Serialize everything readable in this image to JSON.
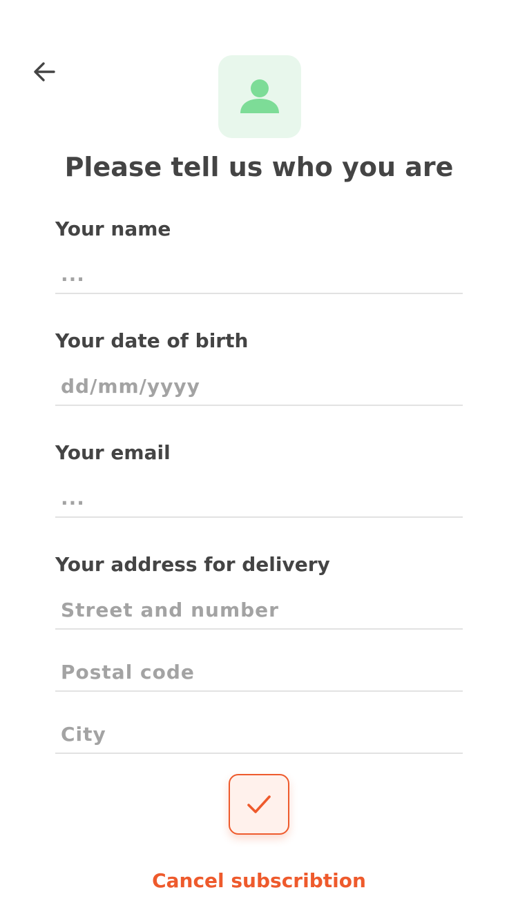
{
  "header": {
    "back_icon": "arrow-left-icon",
    "avatar_icon": "user-icon",
    "title": "Please tell us who you are"
  },
  "form": {
    "name": {
      "label": "Your name",
      "placeholder": "...",
      "value": ""
    },
    "dob": {
      "label": "Your date of birth",
      "placeholder": "dd/mm/yyyy",
      "value": ""
    },
    "email": {
      "label": "Your email",
      "placeholder": "...",
      "value": ""
    },
    "address": {
      "label": "Your address for delivery",
      "street_placeholder": "Street and number",
      "postal_placeholder": "Postal code",
      "city_placeholder": "City"
    }
  },
  "actions": {
    "confirm_icon": "checkmark-icon",
    "cancel_label": "Cancel subscribtion"
  },
  "colors": {
    "accent": "#ee5a2c",
    "accent_bg": "#fff1ec",
    "avatar_bg": "#e8f7ec",
    "avatar_fg": "#7ddc97",
    "text": "#444444",
    "placeholder": "#a3a3a3",
    "divider": "#e2e2e2"
  }
}
